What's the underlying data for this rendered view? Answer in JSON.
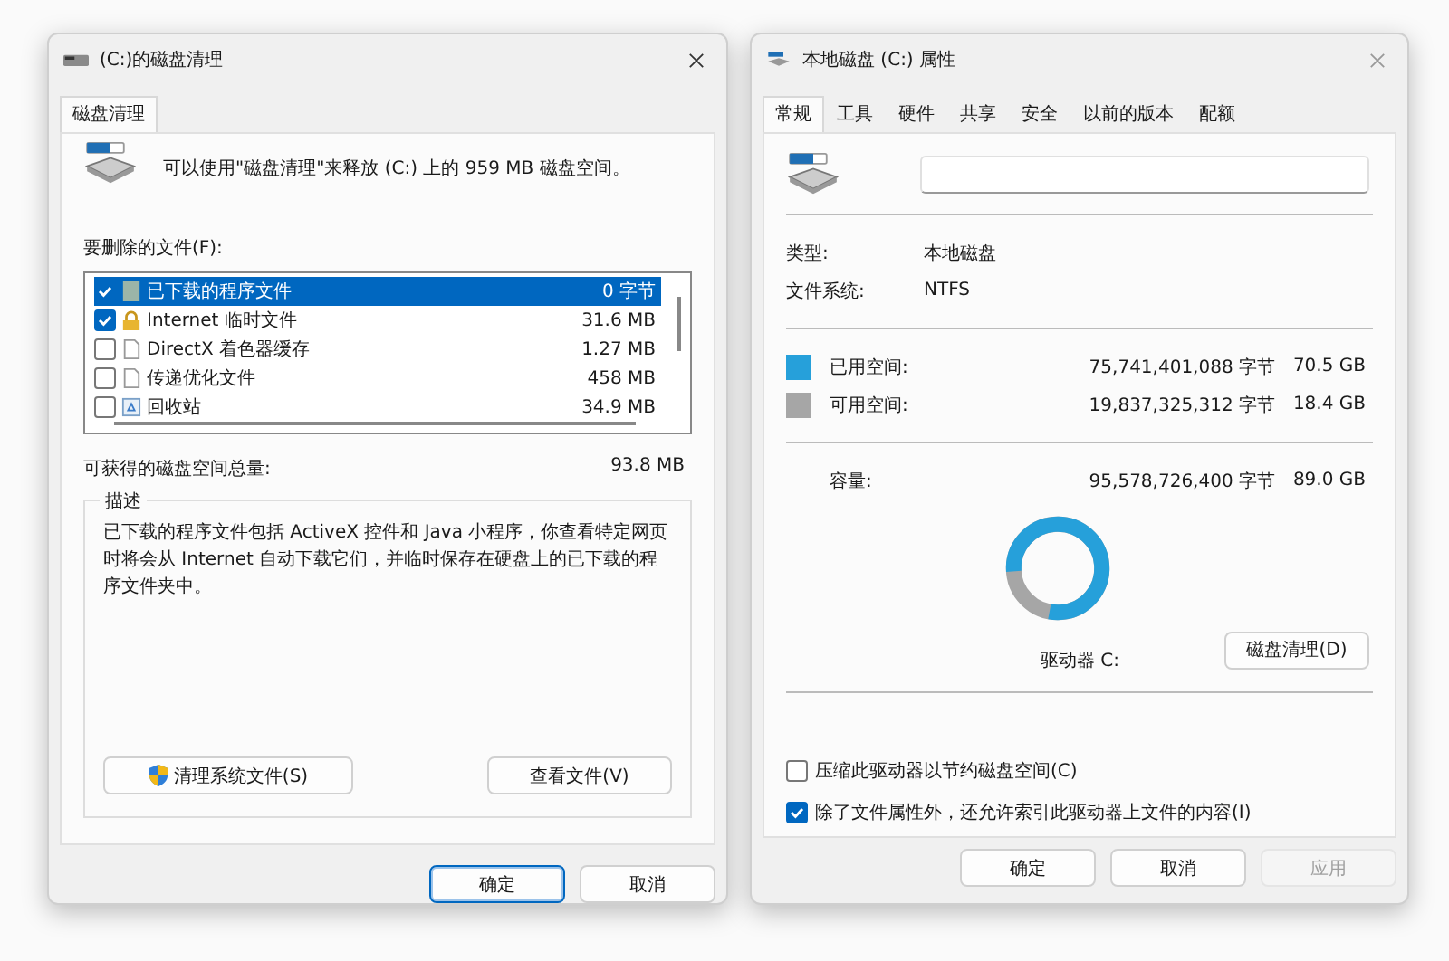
{
  "cleanup_window": {
    "title": "(C:)的磁盘清理",
    "tabs": [
      {
        "label": "磁盘清理",
        "selected": true
      }
    ],
    "message": "可以使用\"磁盘清理\"来释放  (C:) 上的 959 MB 磁盘空间。",
    "files_label": "要删除的文件(F):",
    "files": [
      {
        "name": "已下载的程序文件",
        "size": "0 字节",
        "checked": true,
        "selected": true,
        "kind": "folder"
      },
      {
        "name": "Internet 临时文件",
        "size": "31.6 MB",
        "checked": true,
        "selected": false,
        "kind": "lock"
      },
      {
        "name": "DirectX 着色器缓存",
        "size": "1.27 MB",
        "checked": false,
        "selected": false,
        "kind": "file"
      },
      {
        "name": "传递优化文件",
        "size": "458 MB",
        "checked": false,
        "selected": false,
        "kind": "file"
      },
      {
        "name": "回收站",
        "size": "34.9 MB",
        "checked": false,
        "selected": false,
        "kind": "bin"
      }
    ],
    "total_label": "可获得的磁盘空间总量:",
    "total_value": "93.8 MB",
    "description": {
      "title": "描述",
      "text": "已下载的程序文件包括 ActiveX 控件和 Java 小程序，你查看特定网页时将会从 Internet 自动下载它们，并临时保存在硬盘上的已下载的程序文件夹中。"
    },
    "actions": [
      "清理系统文件(S)",
      "查看文件(V)"
    ],
    "buttons": [
      {
        "label": "确定",
        "default": true
      },
      {
        "label": "取消",
        "default": false
      }
    ]
  },
  "properties_window": {
    "title": "本地磁盘 (C:) 属性",
    "tabs": [
      {
        "label": "常规",
        "selected": true
      },
      {
        "label": "工具",
        "selected": false
      },
      {
        "label": "硬件",
        "selected": false
      },
      {
        "label": "共享",
        "selected": false
      },
      {
        "label": "安全",
        "selected": false
      },
      {
        "label": "以前的版本",
        "selected": false
      },
      {
        "label": "配额",
        "selected": false
      }
    ],
    "info": [
      {
        "label": "类型:",
        "value": "本地磁盘"
      },
      {
        "label": "文件系统:",
        "value": "NTFS"
      }
    ],
    "space": [
      {
        "label": "已用空间:",
        "bytes": "75,741,401,088 字节",
        "size": "70.5 GB",
        "color": "#26a0da"
      },
      {
        "label": "可用空间:",
        "bytes": "19,837,325,312 字节",
        "size": "18.4 GB",
        "color": "#a6a6a6"
      }
    ],
    "capacity": {
      "label": "容量:",
      "bytes": "95,578,726,400 字节",
      "size": "89.0 GB"
    },
    "drive_chart": {
      "level": 0.79
    },
    "drive_label": "驱动器 C:",
    "cleanup_button": "磁盘清理(D)",
    "options": [
      {
        "label": "压缩此驱动器以节约磁盘空间(C)",
        "checked": false
      },
      {
        "label": "除了文件属性外，还允许索引此驱动器上文件的内容(I)",
        "checked": true
      }
    ],
    "buttons": [
      {
        "label": "确定",
        "disabled": false
      },
      {
        "label": "取消",
        "disabled": false
      },
      {
        "label": "应用",
        "disabled": true
      }
    ]
  }
}
